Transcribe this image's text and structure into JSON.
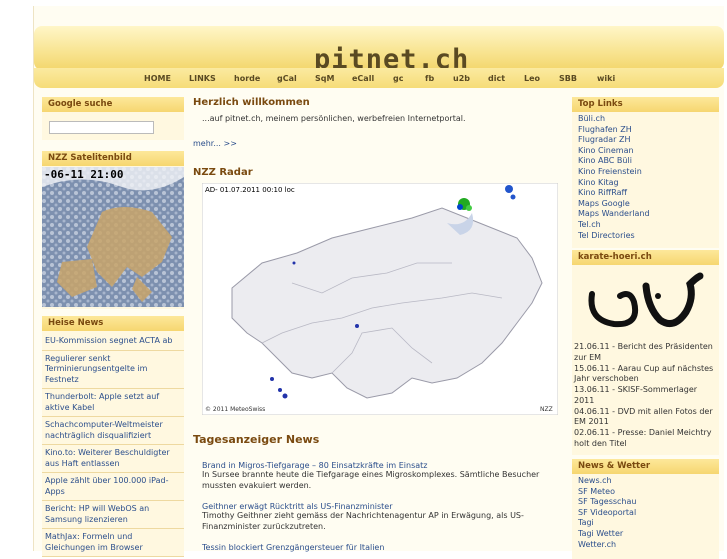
{
  "site": {
    "logo": "pitnet.ch"
  },
  "nav": [
    "HOME",
    "LINKS",
    "horde",
    "gCal",
    "SqM",
    "eCall",
    "gc",
    "fb",
    "u2b",
    "dict",
    "Leo",
    "SBB",
    "wiki"
  ],
  "left": {
    "google_title": "Google suche",
    "nzz_sat_title": "NZZ Satelitenbild",
    "sat_timestamp": "-06-11 21:00",
    "heise_title": "Heise News",
    "heise_items": [
      "EU-Kommission segnet ACTA ab",
      "Regulierer senkt Terminierungsentgelte im Festnetz",
      "Thunderbolt: Apple setzt auf aktive Kabel",
      "Schachcomputer-Weltmeister nachträglich disqualifiziert",
      "Kino.to: Weiterer Beschuldigter aus Haft entlassen",
      "Apple zählt über 100.000 iPad-Apps",
      "Bericht: HP will WebOS an Samsung lizenzieren",
      "MathJax: Formeln und Gleichungen im Browser"
    ]
  },
  "main": {
    "welcome_title": "Herzlich willkommen",
    "welcome_text": "...auf pitnet.ch, meinem persönlichen, werbefreien Internetportal.",
    "more_link": "mehr...  >>",
    "radar_title": "NZZ Radar",
    "radar_stamp": "AD- 01.07.2011 00:10 loc",
    "radar_credit": "© 2011 MeteoSwiss",
    "radar_scale": "NZZ",
    "news_title": "Tagesanzeiger News",
    "news": [
      {
        "headline": "Brand in Migros-Tiefgarage – 80 Einsatzkräfte im Einsatz",
        "text": "In Sursee brannte heute die Tiefgarage eines Migroskomplexes. Sämtliche Besucher mussten evakuiert werden."
      },
      {
        "headline": "Geithner erwägt Rücktritt als US-Finanzminister",
        "text": "Timothy Geithner zieht gemäss der Nachrichtenagentur AP in Erwägung, als US-Finanzminister zurückzutreten."
      },
      {
        "headline": "Tessin blockiert Grenzgängersteuer für Italien",
        "text": ""
      }
    ]
  },
  "right": {
    "toplinks_title": "Top Links",
    "toplinks": [
      "Büli.ch",
      "Flughafen ZH",
      "Flugradar ZH",
      "Kino Cineman",
      "Kino ABC Büli",
      "Kino Freienstein",
      "Kino Kitag",
      "Kino RiffRaff",
      "Maps Google",
      "Maps Wanderland",
      "Tel.ch",
      "Tel Directories"
    ],
    "karate_title": "karate-hoeri.ch",
    "karate_items": [
      "21.06.11 - Bericht des Präsidenten zur EM",
      "15.06.11 - Aarau Cup auf nächstes Jahr verschoben",
      "13.06.11 - SKISF-Sommerlager 2011",
      "04.06.11 - DVD mit allen Fotos der EM 2011",
      "02.06.11 - Presse: Daniel Meichtry holt den Titel"
    ],
    "news_title": "News & Wetter",
    "news_links": [
      "News.ch",
      "SF Meteo",
      "SF Tagesschau",
      "SF Videoportal",
      "Tagi",
      "Tagi Wetter",
      "Wetter.ch"
    ]
  }
}
